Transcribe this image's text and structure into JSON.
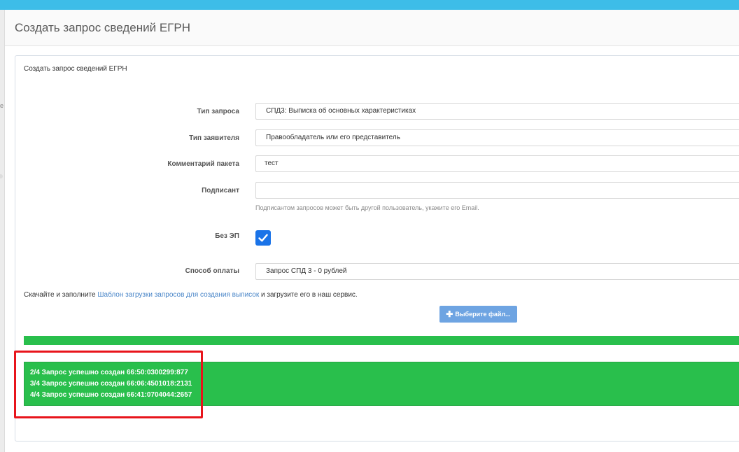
{
  "page": {
    "title": "Создать запрос сведений ЕГРН"
  },
  "card": {
    "heading": "Создать запрос сведений ЕГРН"
  },
  "form": {
    "request_type": {
      "label": "Тип запроса",
      "value": "СПД3: Выписка об основных характеристиках"
    },
    "applicant_type": {
      "label": "Тип заявителя",
      "value": "Правообладатель или его представитель"
    },
    "package_comment": {
      "label": "Комментарий пакета",
      "value": "тест"
    },
    "signer": {
      "label": "Подписант",
      "value": "",
      "help": "Подписантом запросов может быть другой пользователь, укажите его Email."
    },
    "no_ep": {
      "label": "Без ЭП",
      "checked": true
    },
    "payment_method": {
      "label": "Способ оплаты",
      "value": "Запрос СПД 3 - 0 рублей"
    }
  },
  "template": {
    "text_before": "Скачайте и заполните ",
    "link": "Шаблон загрузки запросов для создания выписок",
    "text_after": " и загрузите его в наш сервис."
  },
  "upload": {
    "icon": "plus-icon",
    "label": "Выберите файл..."
  },
  "progress": {
    "percent": 100,
    "color": "#29bf4c"
  },
  "results": [
    "2/4 Запрос успешно создан 66:50:0300299:877",
    "3/4 Запрос успешно создан 66:06:4501018:2131",
    "4/4 Запрос успешно создан 66:41:0704044:2657"
  ],
  "colors": {
    "top_bar": "#3dbde8",
    "success": "#29bf4c",
    "checkbox": "#1a73e8",
    "button": "#6ea4e2",
    "highlight": "#e8141b",
    "link": "#4a86c8"
  }
}
